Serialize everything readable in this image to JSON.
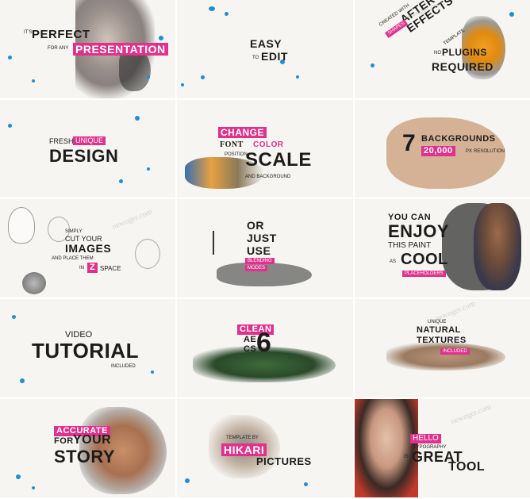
{
  "watermark": "newoger.com",
  "colors": {
    "accent": "#e0318c",
    "splash": "#1f8fd6",
    "text": "#1c1c1c",
    "bg": "#f6f5f2"
  },
  "panels": {
    "p1": {
      "small1": "IT'S",
      "big1": "PERFECT",
      "small2": "FOR ANY",
      "big2": "PRESENTATION"
    },
    "p2": {
      "big1": "EASY",
      "small1": "TO",
      "big2": "EDIT"
    },
    "p3": {
      "big1": "AFTER",
      "big2": "EFFECTS",
      "small1": "TEMPLATE",
      "small2": "CREATED WITH",
      "small3": "SHAPES",
      "small4": "NO",
      "big3": "PLUGINS",
      "big4": "REQUIRED"
    },
    "p4": {
      "word1": "FRESH",
      "word2": "UNIQUE",
      "big": "DESIGN"
    },
    "p5": {
      "word1": "CHANGE",
      "word2": "FONT",
      "word3": "COLOR",
      "small1": "POSITION",
      "big": "SCALE",
      "small2": "AND BACKGROUND"
    },
    "p6": {
      "num": "7",
      "word1": "BACKGROUNDS",
      "word2": "20,000",
      "word3": "PX",
      "small1": "RESOLUTION"
    },
    "p7": {
      "small1": "SIMPLY",
      "word1": "CUT YOUR",
      "big": "IMAGES",
      "small2": "AND PLACE THEM",
      "small3": "IN",
      "word2": "Z",
      "word3": "SPACE"
    },
    "p8": {
      "word1": "OR",
      "word2": "JUST",
      "word3": "USE",
      "word4": "BLENDING",
      "word5": "MODES"
    },
    "p9": {
      "word1": "YOU CAN",
      "big1": "ENJOY",
      "word2": "THIS PAINT",
      "small1": "AS",
      "big2": "COOL",
      "small2": "PLACEHOLDERS"
    },
    "p10": {
      "word1": "VIDEO",
      "big": "TUTORIAL",
      "small1": "INCLUDED"
    },
    "p11": {
      "word1": "CLEAN",
      "word2": "AE",
      "word3": "CS",
      "big": "6"
    },
    "p12": {
      "small1": "UNIQUE",
      "word1": "NATURAL",
      "word2": "TEXTURES",
      "small2": "INCLUDED"
    },
    "p13": {
      "word1": "ACCURATE",
      "word2": "FOR",
      "word3": "YOUR",
      "big": "STORY"
    },
    "p14": {
      "small1": "TEMPLATE BY",
      "big1": "HIKARI",
      "big2": "PICTURES"
    },
    "p15": {
      "word1": "HELLO",
      "small1": "TYPOGRAPHY",
      "small2": "IS",
      "big": "GREAT",
      "word2": "TOOL"
    }
  }
}
